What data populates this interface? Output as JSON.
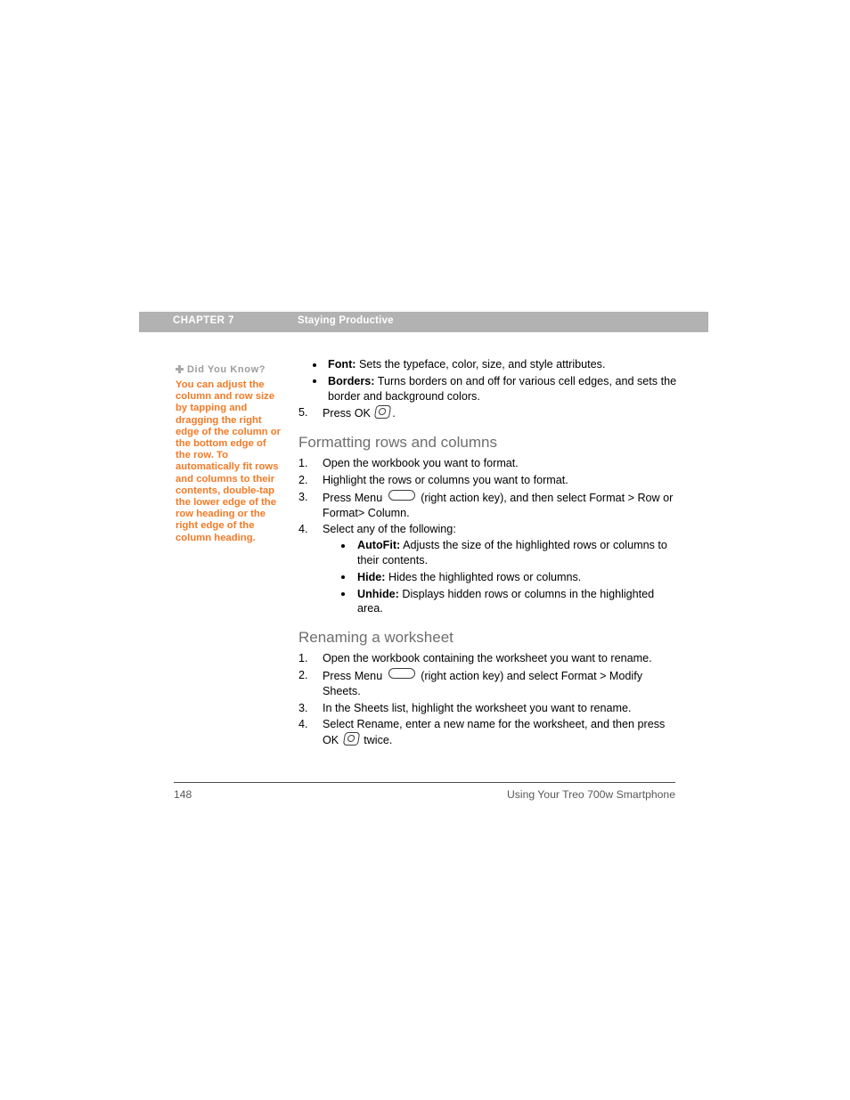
{
  "header": {
    "chapter_label": "CHAPTER 7",
    "chapter_title": "Staying Productive",
    "bar_color": "#b2b2b2",
    "text_color": "#ffffff"
  },
  "sidebar": {
    "tip_heading": "Did You Know?",
    "tip_icon": "plus-icon",
    "tip_body": "You can adjust the column and row size by tapping and dragging the right edge of the column or the bottom edge of the row. To automatically fit rows and columns to their contents, double-tap the lower edge of the row heading or the right edge of the column heading.",
    "tip_color": "#f37a26",
    "heading_color": "#9b9b9b"
  },
  "main": {
    "heading_color": "#6e6e6e",
    "continued_bullets": [
      {
        "term": "Font:",
        "text": " Sets the typeface, color, size, and style attributes."
      },
      {
        "term": "Borders:",
        "text": " Turns borders on and off for various cell edges, and sets the border and background colors."
      }
    ],
    "continued_step": {
      "num": "5.",
      "pre": "Press OK ",
      "icon": "ok-key-icon",
      "post": "."
    },
    "sections": [
      {
        "heading": "Formatting rows and columns",
        "steps": [
          {
            "num": "1.",
            "text": "Open the workbook you want to format."
          },
          {
            "num": "2.",
            "text": "Highlight the rows or columns you want to format."
          },
          {
            "num": "3.",
            "pre": "Press Menu ",
            "icon": "menu-key-icon",
            "post": " (right action key), and then select Format > Row or Format> Column."
          },
          {
            "num": "4.",
            "text": "Select any of the following:",
            "bullets": [
              {
                "term": "AutoFit:",
                "text": " Adjusts the size of the highlighted rows or columns to their contents."
              },
              {
                "term": "Hide:",
                "text": " Hides the highlighted rows or columns."
              },
              {
                "term": "Unhide:",
                "text": " Displays hidden rows or columns in the highlighted area."
              }
            ]
          }
        ]
      },
      {
        "heading": "Renaming a worksheet",
        "steps": [
          {
            "num": "1.",
            "text": "Open the workbook containing the worksheet you want to rename."
          },
          {
            "num": "2.",
            "pre": "Press Menu ",
            "icon": "menu-key-icon",
            "post": " (right action key) and select Format > Modify Sheets."
          },
          {
            "num": "3.",
            "text": "In the Sheets list, highlight the worksheet you want to rename."
          },
          {
            "num": "4.",
            "pre": "Select Rename, enter a new name for the worksheet, and then press OK ",
            "icon": "ok-key-icon",
            "post": " twice."
          }
        ]
      }
    ]
  },
  "footer": {
    "page_number": "148",
    "book_title": "Using Your Treo 700w Smartphone",
    "text_color": "#58585a"
  }
}
